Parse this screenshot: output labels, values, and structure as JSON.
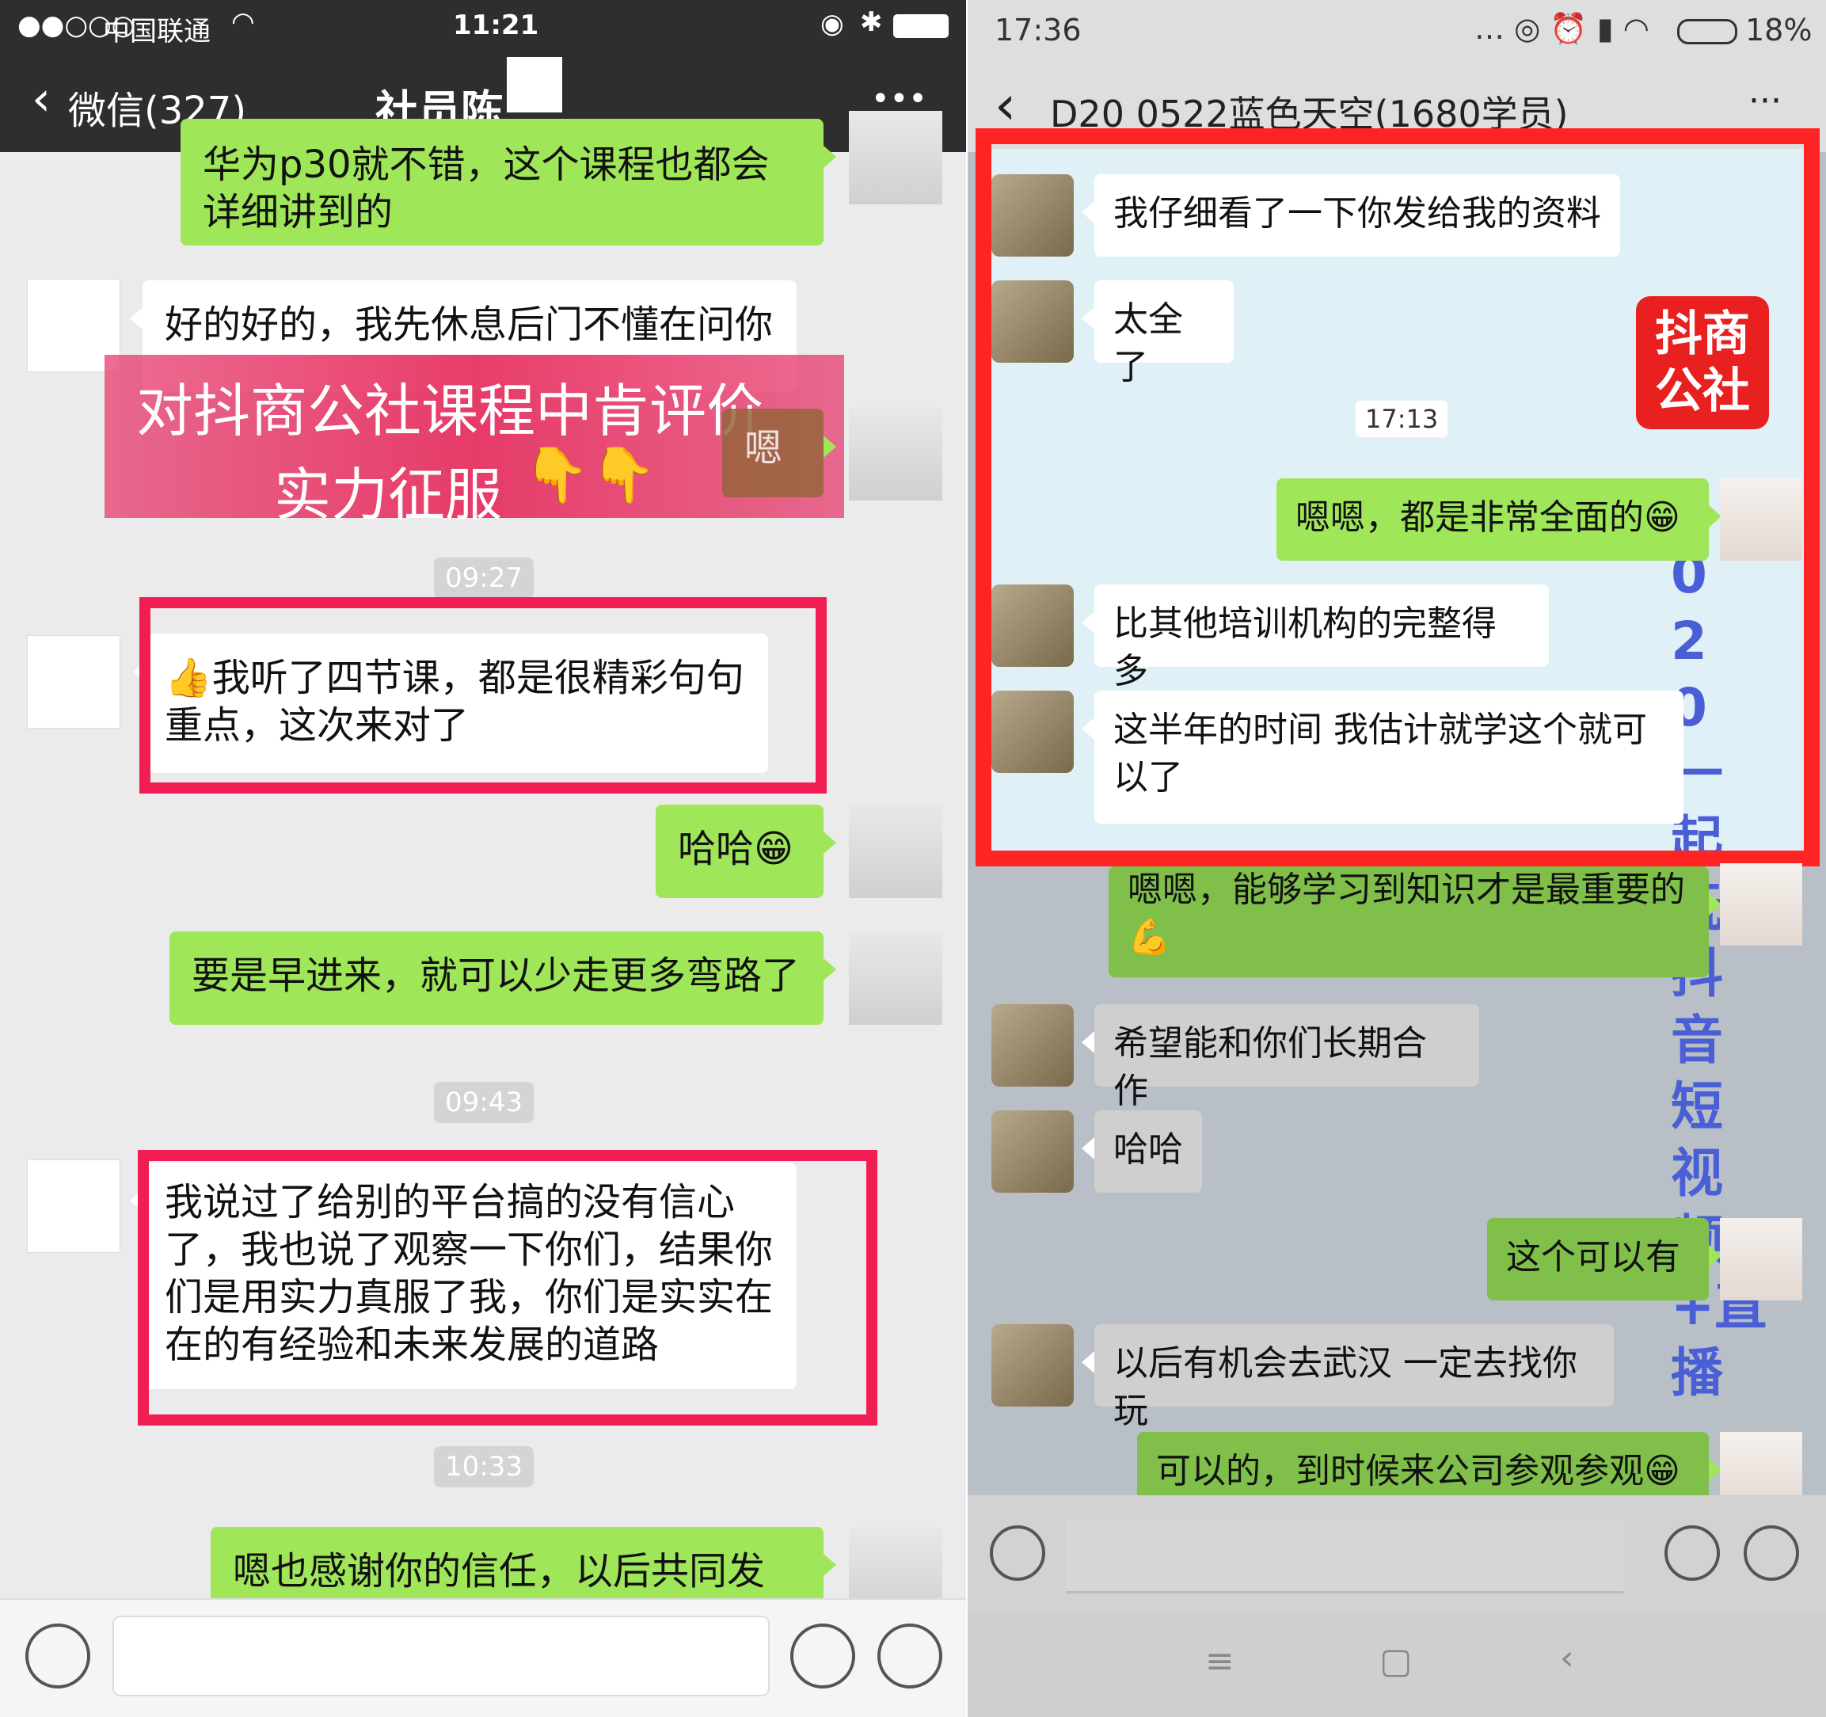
{
  "left": {
    "status": {
      "signal": "●●○○○",
      "carrier": "中国联通",
      "time": "11:21"
    },
    "nav": {
      "back": "微信(327)",
      "title": "社员陈",
      "more": "•••"
    },
    "messages": {
      "m1": "华为p30就不错，这个课程也都会详细讲到的",
      "m2": "好的好的，我先休息后门不懂在问你",
      "m3": "嗯",
      "t1": "09:27",
      "m4": "我听了四节课，都是很精彩句句重点，这次来对了",
      "m5": "哈哈",
      "m6": "要是早进来，就可以少走更多弯路了",
      "t2": "09:43",
      "m7": "我说过了给别的平台搞的没有信心了，我也说了观察一下你们，结果你们是用实力真服了我，你们是实实在在的有经验和未来发展的道路",
      "t3": "10:33",
      "m8": "嗯也感谢你的信任，以后共同发展"
    },
    "banner": {
      "line1": "对抖商公社课程中肯评价",
      "line2": "实力征服"
    }
  },
  "right": {
    "status": {
      "time": "17:36",
      "battery": "18%"
    },
    "nav": {
      "title": "D20 0522蓝色天空(1680学员)",
      "more": "···"
    },
    "messages": {
      "r1": "我仔细看了一下你发给我的资料",
      "r2": "太全了",
      "rt": "17:13",
      "r3": "嗯嗯，都是非常全面的",
      "r4": "比其他培训机构的完整得多",
      "r5": "这半年的时间 我估计就学这个就可以了",
      "r6": "嗯嗯，能够学习到知识才是最重要的",
      "r7": "希望能和你们长期合作",
      "r8": "哈哈",
      "r9": "这个可以有",
      "r10": "以后有机会去武汉 一定去找你玩",
      "r11": "可以的，到时候来公司参观参观"
    },
    "logo": "抖商公社",
    "watermark": "2020一起玩抖音短视频+直播"
  },
  "colors": {
    "green": "#9fe658",
    "redbox_left": "#f01e52",
    "redbox_right": "#ff2424"
  }
}
